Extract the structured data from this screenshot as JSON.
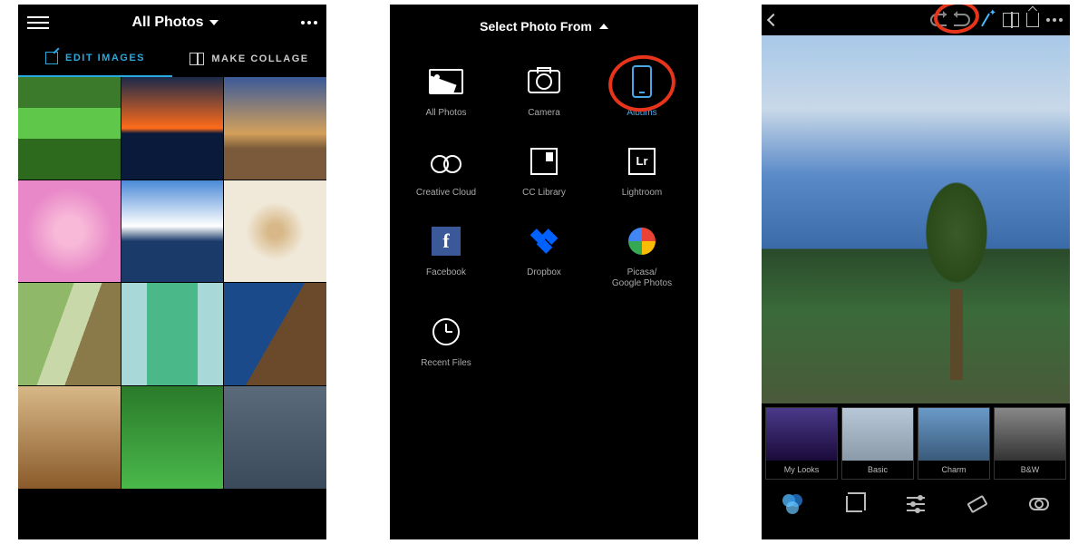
{
  "screen1": {
    "title": "All Photos",
    "tabs": {
      "edit": "EDIT IMAGES",
      "collage": "MAKE COLLAGE"
    }
  },
  "screen2": {
    "header": "Select Photo From",
    "sources": {
      "all_photos": "All Photos",
      "camera": "Camera",
      "albums": "Albums",
      "creative_cloud": "Creative Cloud",
      "cc_library": "CC Library",
      "lightroom": "Lightroom",
      "facebook": "Facebook",
      "dropbox": "Dropbox",
      "picasa": "Picasa/\nGoogle Photos",
      "recent": "Recent Files"
    },
    "lr_badge": "Lr"
  },
  "screen3": {
    "looks": {
      "my_looks": "My Looks",
      "basic": "Basic",
      "charm": "Charm",
      "bw": "B&W"
    }
  }
}
